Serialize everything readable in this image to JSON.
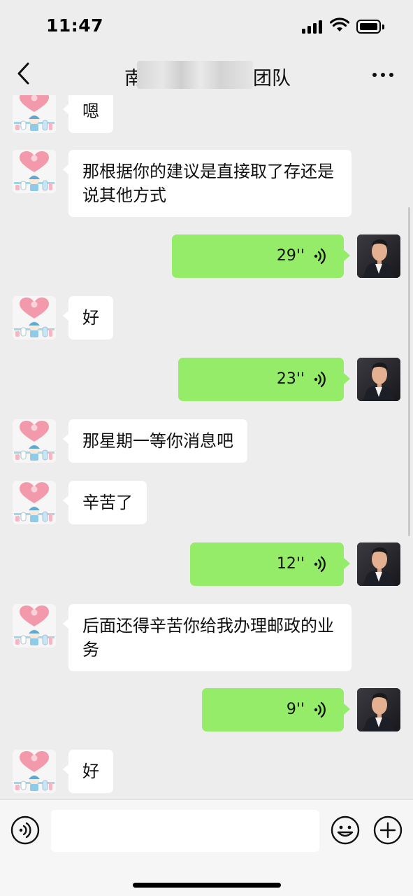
{
  "status_bar": {
    "time": "11:47"
  },
  "nav": {
    "title_start": "南",
    "title_end": "团队",
    "back_icon": "chevron-left-icon",
    "more_icon": "ellipsis-icon"
  },
  "messages": [
    {
      "side": "left",
      "type": "text",
      "text": "嗯"
    },
    {
      "side": "left",
      "type": "text",
      "text": "那根据你的建议是直接取了存还是说其他方式"
    },
    {
      "side": "right",
      "type": "voice",
      "duration": "29''"
    },
    {
      "side": "left",
      "type": "text",
      "text": "好"
    },
    {
      "side": "right",
      "type": "voice",
      "duration": "23''"
    },
    {
      "side": "left",
      "type": "text",
      "text": "那星期一等你消息吧"
    },
    {
      "side": "left",
      "type": "text",
      "text": "辛苦了"
    },
    {
      "side": "right",
      "type": "voice",
      "duration": "12''"
    },
    {
      "side": "left",
      "type": "text",
      "text": "后面还得辛苦你给我办理邮政的业务"
    },
    {
      "side": "right",
      "type": "voice",
      "duration": "9''"
    },
    {
      "side": "left",
      "type": "text",
      "text": "好"
    }
  ],
  "input_bar": {
    "voice_toggle_icon": "voice-wave-icon",
    "input_value": "",
    "emoji_icon": "emoji-smile-icon",
    "plus_icon": "plus-circle-icon"
  },
  "colors": {
    "background": "#ededed",
    "incoming_bubble": "#ffffff",
    "outgoing_bubble": "#95ec69",
    "input_bar": "#f6f6f6"
  }
}
